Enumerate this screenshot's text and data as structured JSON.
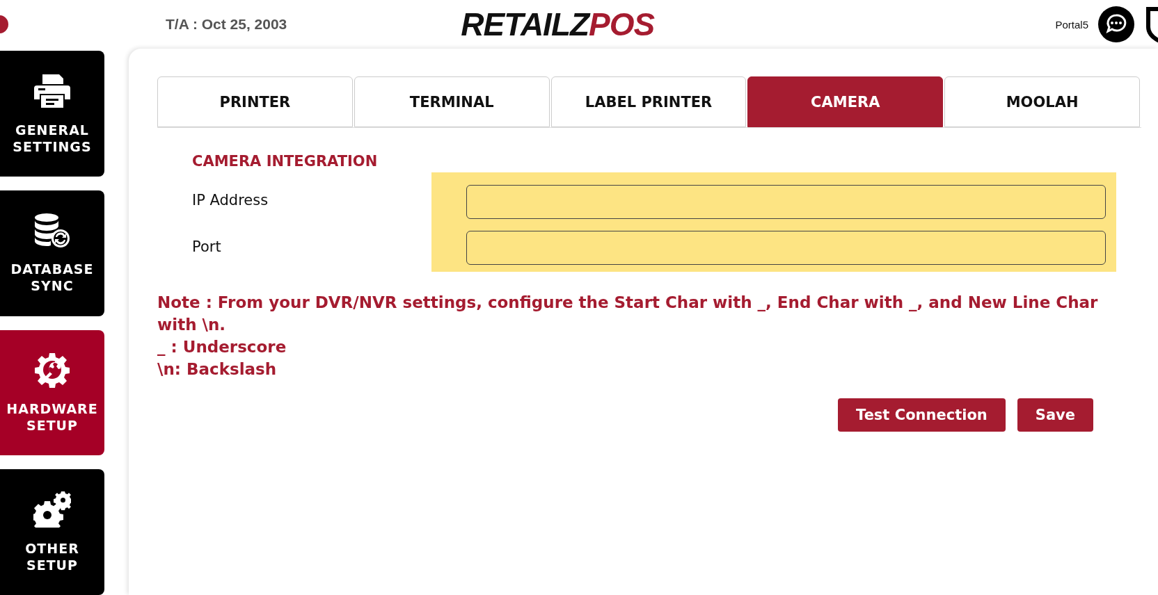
{
  "header": {
    "date": "T/A : Oct 25, 2003",
    "logo": {
      "part_1": "RETAILZ",
      "part_2": "POS"
    },
    "user": "Portal5"
  },
  "sidebar": {
    "items": [
      {
        "label": "GENERAL SETTINGS",
        "kind": "printer",
        "selected": false
      },
      {
        "label": "DATABASE SYNC",
        "kind": "database",
        "selected": false
      },
      {
        "label": "HARDWARE SETUP",
        "kind": "wrench",
        "selected": true
      },
      {
        "label": "OTHER SETUP",
        "kind": "gears",
        "selected": false
      }
    ]
  },
  "tabs": [
    {
      "label": "PRINTER",
      "selected": false
    },
    {
      "label": "TERMINAL",
      "selected": false
    },
    {
      "label": "LABEL PRINTER",
      "selected": false
    },
    {
      "label": "CAMERA",
      "selected": true
    },
    {
      "label": "MOOLAH",
      "selected": false
    }
  ],
  "section_title": "CAMERA INTEGRATION",
  "fields": [
    {
      "label": "IP Address"
    },
    {
      "label": "Port"
    }
  ],
  "notes": [
    "Note : From your DVR/NVR settings, configure the Start Char with _, End Char with _, and New Line Char with \\n.",
    "_ : Underscore",
    "\\n: Backslash"
  ],
  "buttons": [
    "Test Connection",
    "Save"
  ]
}
